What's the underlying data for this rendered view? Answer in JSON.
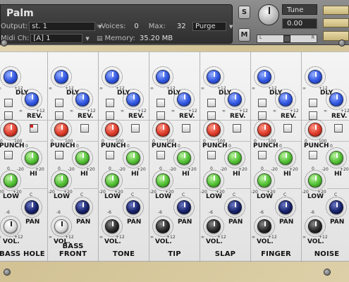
{
  "header": {
    "instrument_name": "Palm",
    "output_label": "Output:",
    "output_value": "st. 1",
    "voices_label": "Voices:",
    "voices_value": "0",
    "max_label": "Max:",
    "max_value": "32",
    "purge_label": "Purge",
    "midi_label": "Midi Ch:",
    "midi_value": "[A]  1",
    "memory_label": "Memory:",
    "memory_value": "35.20 MB",
    "solo_label": "S",
    "mute_label": "M",
    "tune_label": "Tune",
    "tune_value": "0.00",
    "pan_left": "L",
    "pan_right": "R"
  },
  "knob_labels": {
    "delay": "DLY.",
    "reverb": "REV.",
    "punch": "PUNCH",
    "hi": "HI",
    "low": "LOW",
    "pan": "PAN",
    "volume": "VOL."
  },
  "scale_labels": {
    "inf": "∞",
    "plus12": "+12",
    "zero": "0",
    "hundred": "100",
    "minus20": "-20",
    "plus20": "+20",
    "c": "C",
    "minus6": "-6"
  },
  "channels": [
    {
      "name": "BASS HOLE",
      "vol_knob": "white"
    },
    {
      "name": "BASS FRONT",
      "vol_knob": "white"
    },
    {
      "name": "TONE",
      "vol_knob": "black"
    },
    {
      "name": "TIP",
      "vol_knob": "black"
    },
    {
      "name": "SLAP",
      "vol_knob": "black"
    },
    {
      "name": "FINGER",
      "vol_knob": "black"
    },
    {
      "name": "NOISE",
      "vol_knob": "black"
    }
  ],
  "colors": {
    "delay_reverb": "#3056e0",
    "punch": "#dd3b2a",
    "eq": "#52c034",
    "pan": "#18236c",
    "header_bg": "#6e6e6e",
    "panel_bg": "#ececec",
    "wood": "#d6c79c"
  },
  "icons": {
    "screw": "screw-icon",
    "voices": "voices-icon",
    "memory": "memory-icon",
    "dropdown": "chevron-down-icon"
  }
}
